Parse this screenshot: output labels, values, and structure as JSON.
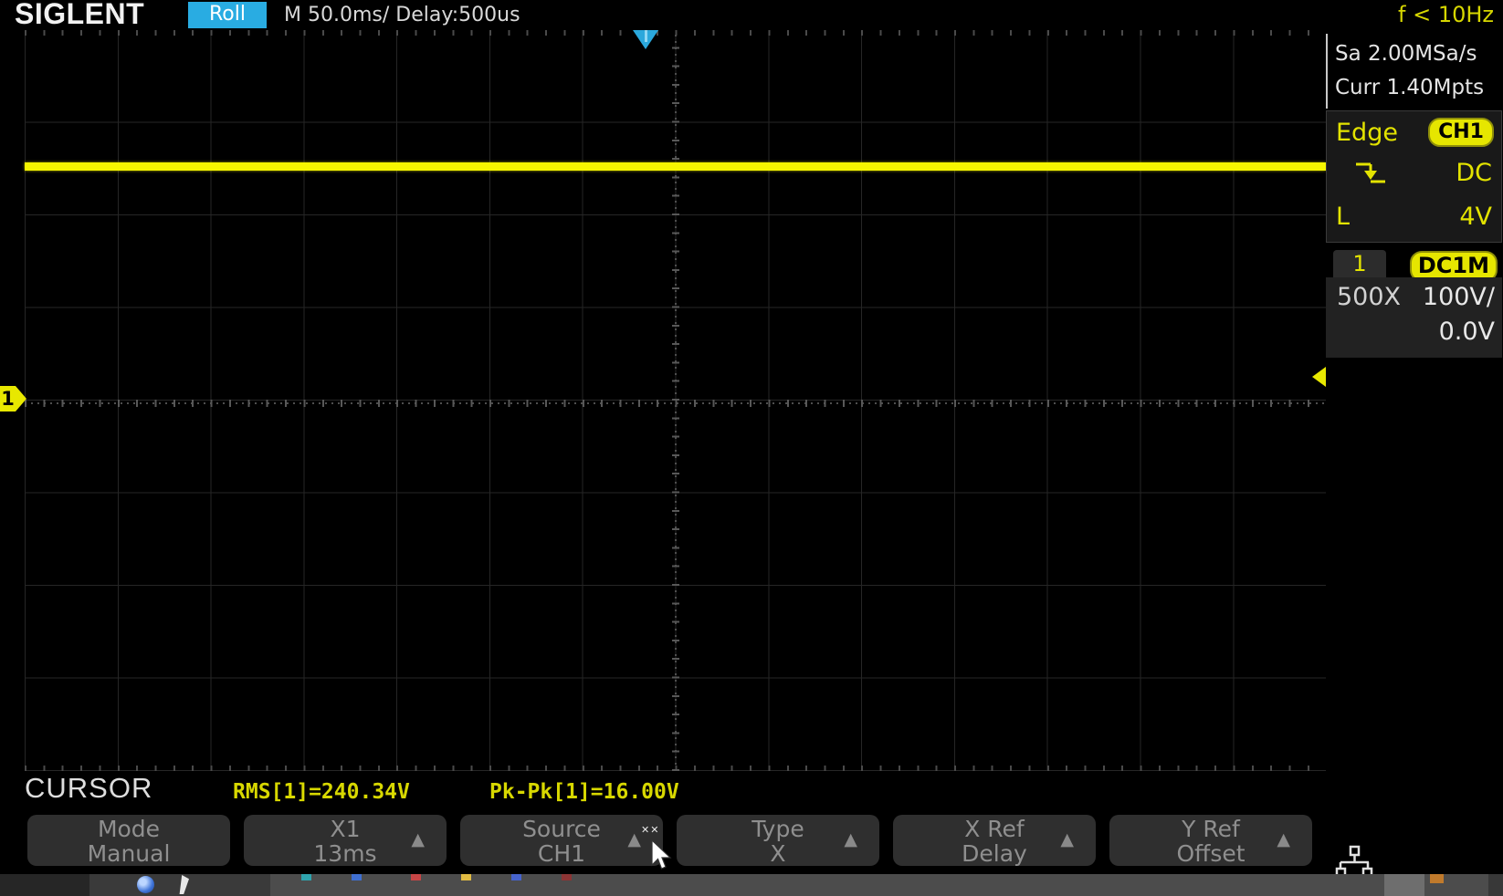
{
  "header": {
    "brand": "SIGLENT",
    "acq_mode_badge": "Roll",
    "timebase": "M 50.0ms/ Delay:500us",
    "freq_counter": "f < 10Hz"
  },
  "acquisition": {
    "sample_rate": "Sa 2.00MSa/s",
    "memory_depth": "Curr 1.40Mpts"
  },
  "trigger_panel": {
    "mode": "Edge",
    "source": "CH1",
    "slope": "falling",
    "coupling": "DC",
    "level_label": "L",
    "level_value": "4V"
  },
  "channel_panel": {
    "channel": "1",
    "coupling": "DC1M",
    "probe_atten": "500X",
    "volts_per_div": "100V/",
    "offset": "0.0V"
  },
  "waveform": {
    "channel_marker": "1",
    "trace_description": "flat horizontal CH1 trace 2.4 divisions above center"
  },
  "measurements": {
    "menu_title": "CURSOR",
    "rms": "RMS[1]=240.34V",
    "pk_pk": "Pk-Pk[1]=16.00V"
  },
  "menu": {
    "arrow_glyph": "▲",
    "buttons": [
      {
        "top": "Mode",
        "bottom": "Manual"
      },
      {
        "top": "X1",
        "bottom": "13ms"
      },
      {
        "top": "Source",
        "bottom": "CH1"
      },
      {
        "top": "Type",
        "bottom": "X"
      },
      {
        "top": "X Ref",
        "bottom": "Delay"
      },
      {
        "top": "Y Ref",
        "bottom": "Offset"
      }
    ]
  },
  "colors": {
    "accent_yellow": "#e3e300",
    "trace_yellow": "#f6f600",
    "roll_badge_cyan": "#29ACE2",
    "trigger_marker_cyan": "#2BA8DC",
    "text_white": "#d9d9d9",
    "menu_text_gray": "#8f8f8f"
  }
}
